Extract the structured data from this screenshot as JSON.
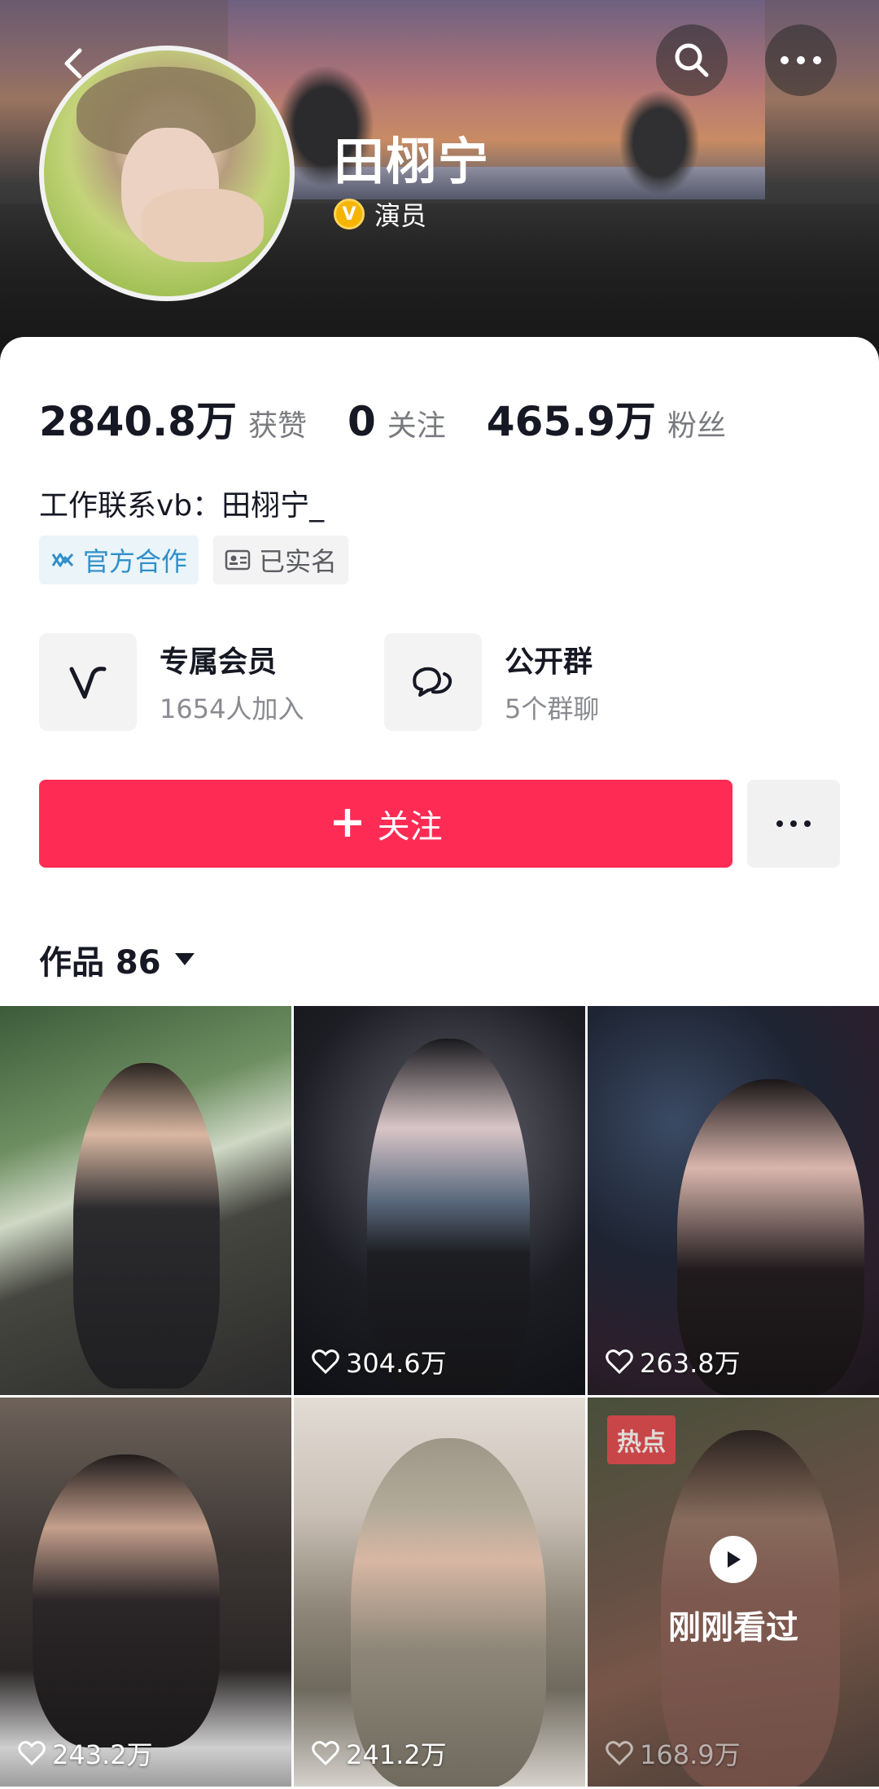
{
  "profile": {
    "name": "田栩宁",
    "verify_label": "演员",
    "verify_badge": "V",
    "bio": "工作联系vb：田栩宁_"
  },
  "stats": [
    {
      "value": "2840.8万",
      "label": "获赞"
    },
    {
      "value": "0",
      "label": "关注"
    },
    {
      "value": "465.9万",
      "label": "粉丝"
    }
  ],
  "tags": {
    "official": "官方合作",
    "realname": "已实名"
  },
  "features": {
    "member": {
      "title": "专属会员",
      "sub": "1654人加入"
    },
    "group": {
      "title": "公开群",
      "sub": "5个群聊"
    }
  },
  "actions": {
    "follow_label": "关注"
  },
  "works": {
    "title": "作品 86",
    "items": [
      {
        "likes": ""
      },
      {
        "likes": "304.6万"
      },
      {
        "likes": "263.8万"
      },
      {
        "likes": "243.2万"
      },
      {
        "likes": "241.2万"
      },
      {
        "likes": "168.9万",
        "badge": "热点",
        "status": "刚刚看过"
      }
    ]
  },
  "colors": {
    "accent": "#fe2c55",
    "verify": "#f5b400",
    "official_tag": "#2f8fc9"
  }
}
